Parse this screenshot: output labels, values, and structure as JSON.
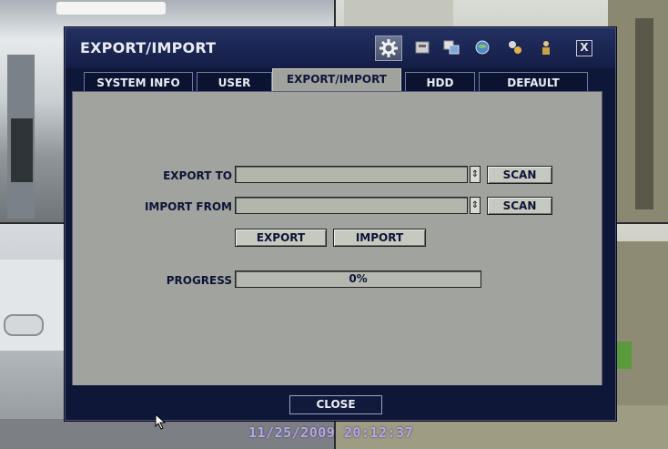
{
  "dialog": {
    "title": "EXPORT/IMPORT",
    "toolbar_icons": [
      "gear-icon",
      "monitor-icon",
      "display-icon",
      "globe-icon",
      "network-icon",
      "person-icon",
      "close-icon"
    ],
    "close_symbol": "X"
  },
  "tabs": [
    {
      "label": "SYSTEM INFO"
    },
    {
      "label": "USER"
    },
    {
      "label": "EXPORT/IMPORT",
      "active": true
    },
    {
      "label": "HDD"
    },
    {
      "label": "DEFAULT"
    }
  ],
  "export_to": {
    "label": "EXPORT TO",
    "value": "",
    "scan_label": "SCAN"
  },
  "import_from": {
    "label": "IMPORT FROM",
    "value": "",
    "scan_label": "SCAN"
  },
  "actions": {
    "export_label": "EXPORT",
    "import_label": "IMPORT"
  },
  "progress": {
    "label": "PROGRESS",
    "value_text": "0%",
    "fraction": 0
  },
  "footer": {
    "close_label": "CLOSE"
  },
  "overlay": {
    "timestamp": "11/25/2009 20:12:37"
  },
  "colors": {
    "dialog_bg": "#0f1738",
    "panel_bg": "#a1a49e",
    "active_tab": "#a0a39d",
    "timestamp": "#b7a9d8"
  }
}
